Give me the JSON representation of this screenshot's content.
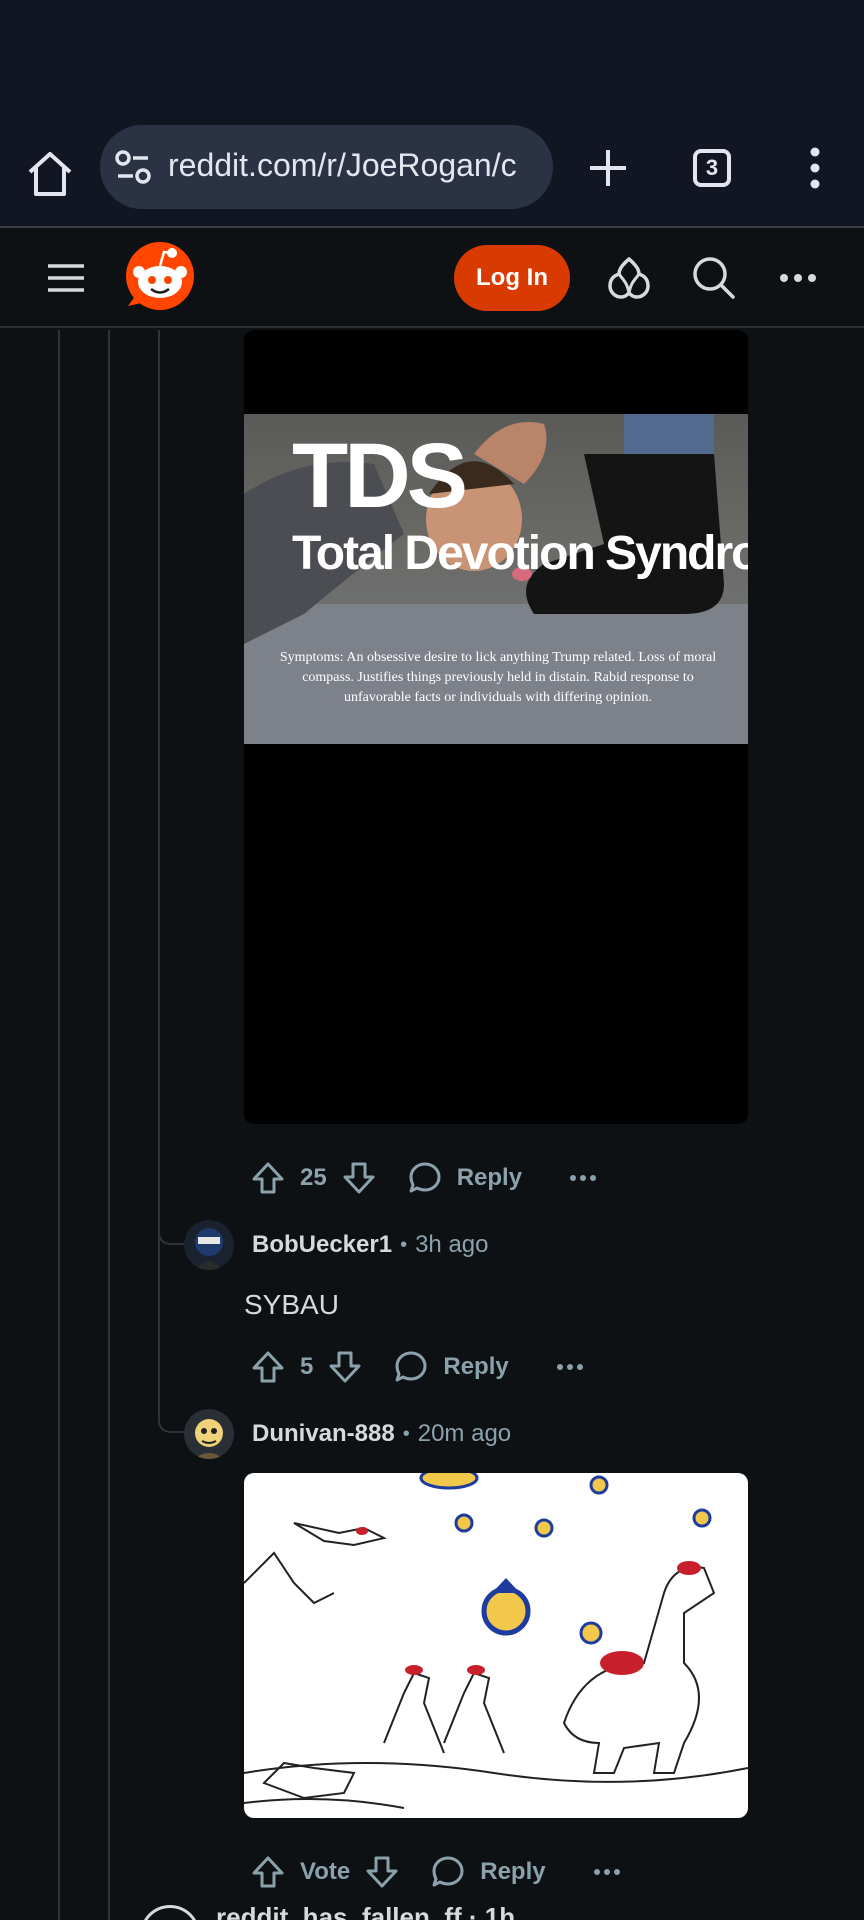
{
  "browser": {
    "url": "reddit.com/r/JoeRogan/c",
    "tab_count": "3"
  },
  "header": {
    "login_label": "Log In"
  },
  "comments": [
    {
      "image": {
        "title": "TDS",
        "subtitle": "Total Devotion Syndrome",
        "symptoms": "Symptoms:  An obsessive desire to lick anything Trump related.  Loss of moral compass. Justifies things previously held in distain. Rabid response to unfavorable facts or individuals with differing opinion."
      },
      "score": "25",
      "reply_label": "Reply"
    },
    {
      "author": "BobUecker1",
      "separator": "•",
      "time": "3h ago",
      "body": "SYBAU",
      "score": "5",
      "reply_label": "Reply"
    },
    {
      "author": "Dunivan-888",
      "separator": "•",
      "time": "20m ago",
      "score": "Vote",
      "reply_label": "Reply"
    }
  ],
  "next_comment_peek": "reddit_has_fallen_ff · 1h"
}
